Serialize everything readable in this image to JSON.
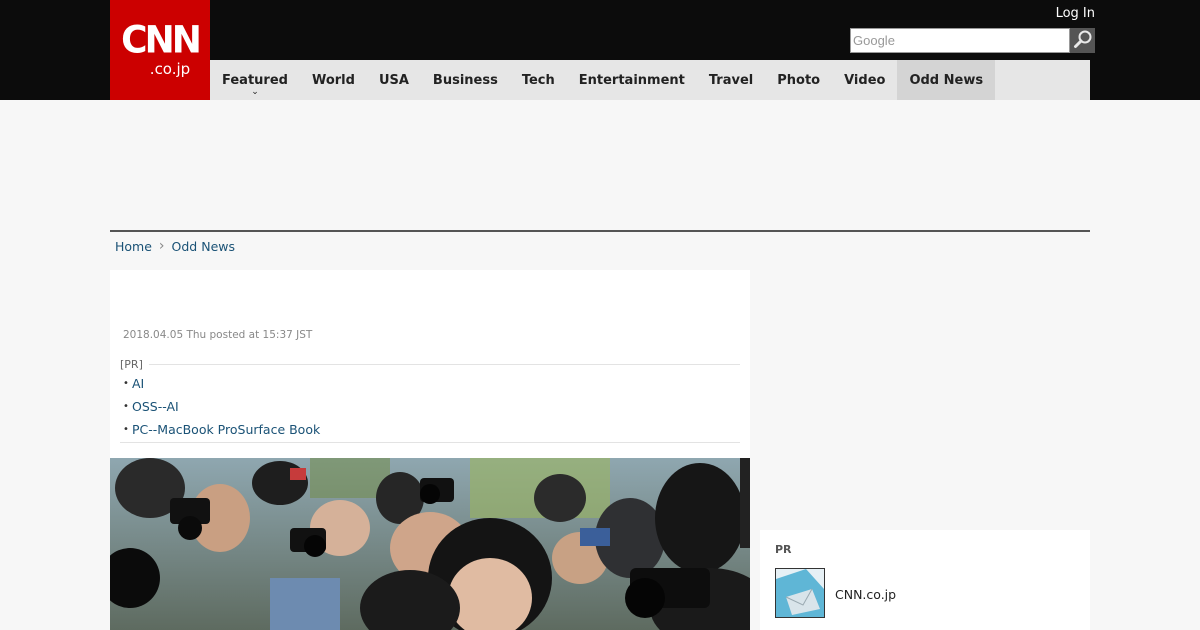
{
  "header": {
    "logo_main": "CNN",
    "logo_sub": ".co.jp",
    "login_label": "Log In",
    "search_placeholder": "Google"
  },
  "nav": {
    "items": [
      {
        "label": "Featured"
      },
      {
        "label": "World"
      },
      {
        "label": "USA"
      },
      {
        "label": "Business"
      },
      {
        "label": "Tech"
      },
      {
        "label": "Entertainment"
      },
      {
        "label": "Travel"
      },
      {
        "label": "Photo"
      },
      {
        "label": "Video"
      },
      {
        "label": "Odd News"
      }
    ],
    "caret": "⌄"
  },
  "breadcrumb": {
    "home": "Home",
    "separator": "›",
    "current": "Odd News"
  },
  "article": {
    "date": "2018.04.05 Thu posted at 15:37 JST",
    "pr_label": "[PR]",
    "pr_links": [
      "AI",
      "OSS--AI",
      "PC--MacBook ProSurface Book"
    ],
    "bullet": "•"
  },
  "sidebar_pr": {
    "label": "PR",
    "item_title": "CNN.co.jp"
  },
  "colors": {
    "brand_red": "#cc0000",
    "top_bar": "#0c0c0c",
    "nav_bg": "#e6e6e6",
    "link": "#1a5276"
  },
  "icons": {
    "search": "search-icon",
    "breadcrumb_separator": "chevron-right-icon",
    "nav_dropdown": "chevron-down-icon"
  }
}
